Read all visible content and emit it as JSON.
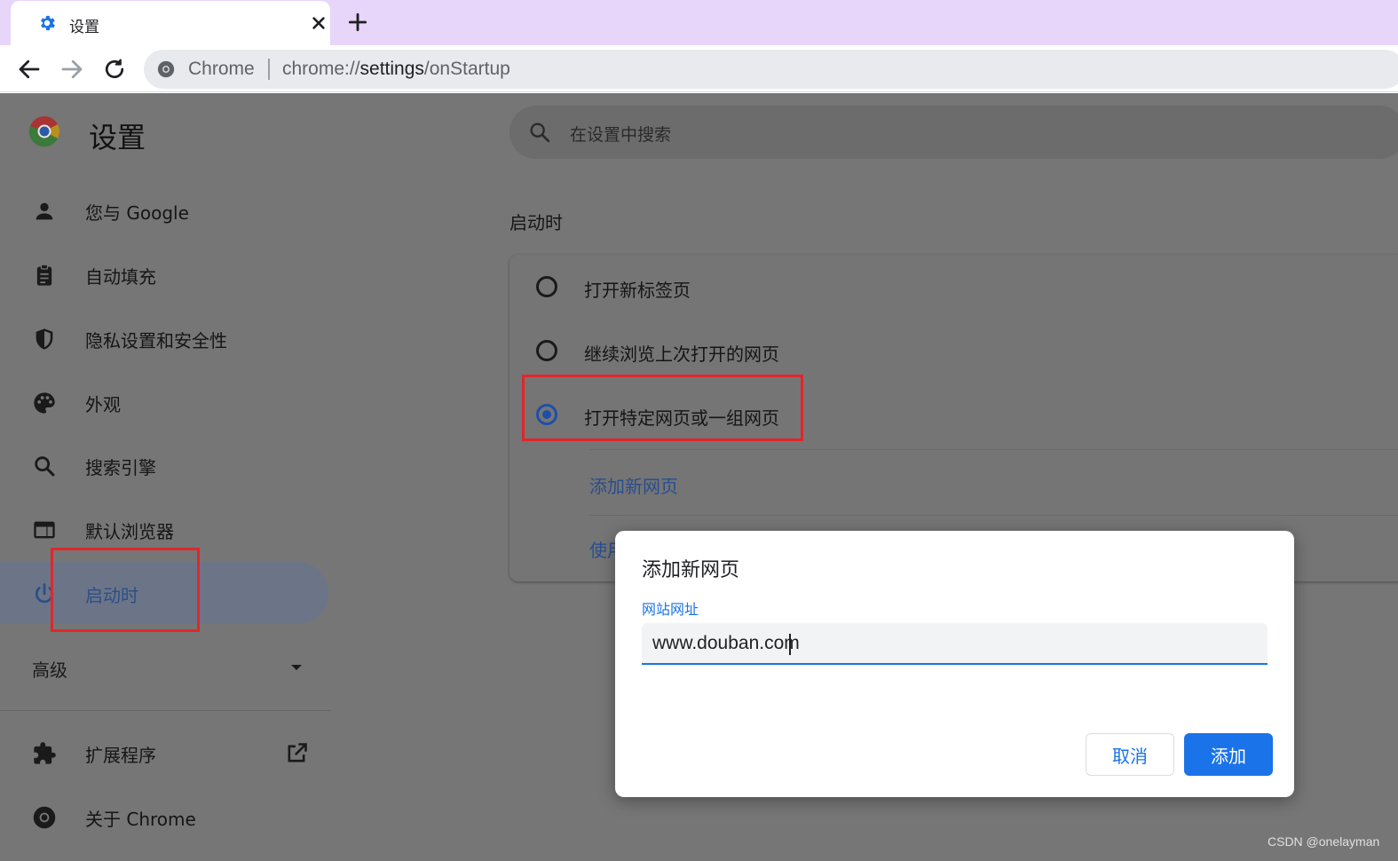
{
  "browser": {
    "tab_title": "设置",
    "omnibox_chip": "Chrome",
    "url_scheme": "chrome://",
    "url_host": "settings",
    "url_path": "/onStartup"
  },
  "settings": {
    "title": "设置",
    "search_placeholder": "在设置中搜索",
    "nav": [
      {
        "label": "您与 Google",
        "icon": "person-icon"
      },
      {
        "label": "自动填充",
        "icon": "clipboard-icon"
      },
      {
        "label": "隐私设置和安全性",
        "icon": "shield-icon"
      },
      {
        "label": "外观",
        "icon": "palette-icon"
      },
      {
        "label": "搜索引擎",
        "icon": "search-icon"
      },
      {
        "label": "默认浏览器",
        "icon": "browser-icon"
      },
      {
        "label": "启动时",
        "icon": "power-icon",
        "active": true
      }
    ],
    "advanced_label": "高级",
    "extensions_label": "扩展程序",
    "about_label": "关于 Chrome"
  },
  "startup": {
    "section_title": "启动时",
    "options": [
      {
        "label": "打开新标签页",
        "selected": false
      },
      {
        "label": "继续浏览上次打开的网页",
        "selected": false
      },
      {
        "label": "打开特定网页或一组网页",
        "selected": true
      }
    ],
    "add_page_link": "添加新网页",
    "use_current_link": "使用"
  },
  "dialog": {
    "title": "添加新网页",
    "field_label": "网站网址",
    "field_value": "www.douban.com",
    "cancel_label": "取消",
    "add_label": "添加"
  },
  "watermark": "CSDN @onelayman",
  "colors": {
    "accent": "#1a73e8",
    "highlight": "#e2262b",
    "tabstrip": "#e8d5fa"
  }
}
